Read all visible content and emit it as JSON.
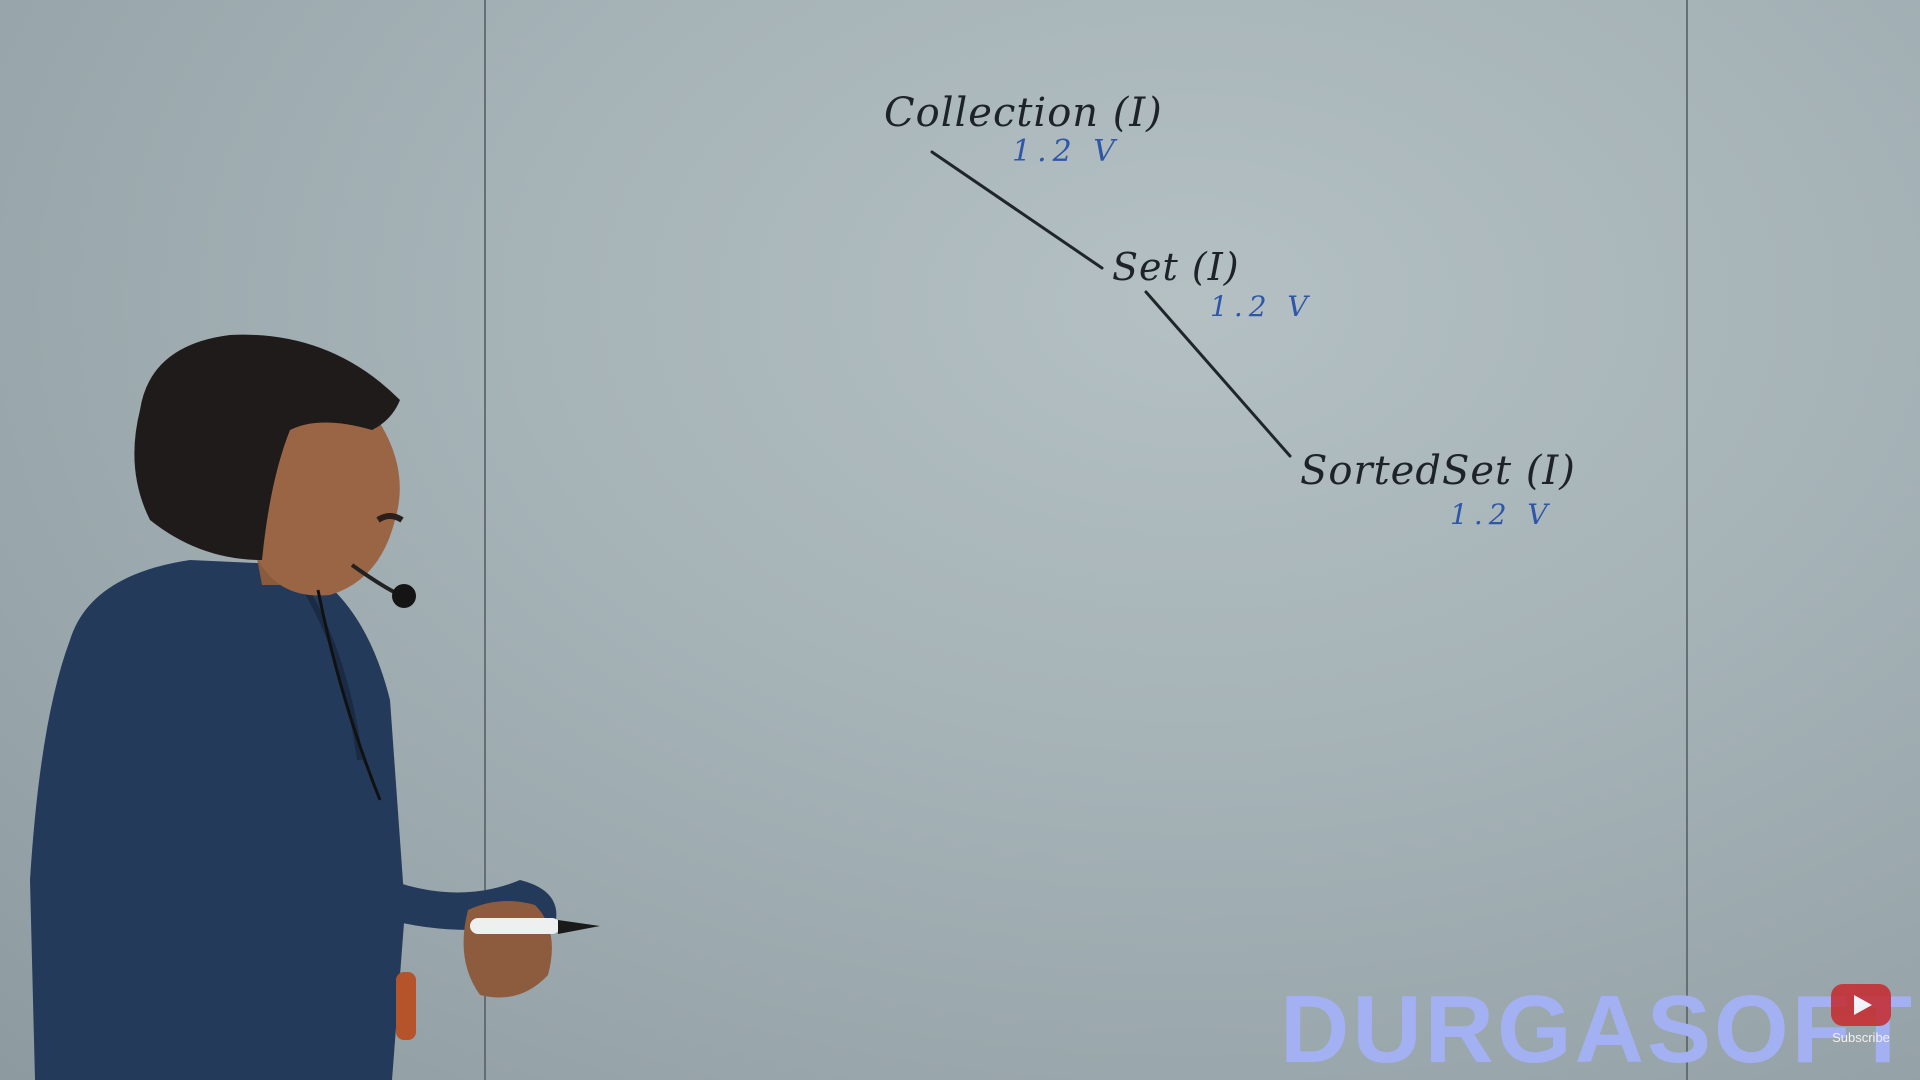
{
  "whiteboard": {
    "nodes": [
      {
        "label": "Collection (I)",
        "version": "1.2 V"
      },
      {
        "label": "Set (I)",
        "version": "1.2 V"
      },
      {
        "label": "SortedSet (I)",
        "version": "1.2 V"
      }
    ]
  },
  "watermark": {
    "text": "DURGASOFT",
    "color": "#a3b1f2"
  },
  "subscribe_button": {
    "label": "Subscribe",
    "icon": "youtube-play-icon"
  },
  "colors": {
    "ink": "#1d2327",
    "blue_ink": "#2f57a8",
    "board": "#a6b3b7"
  }
}
